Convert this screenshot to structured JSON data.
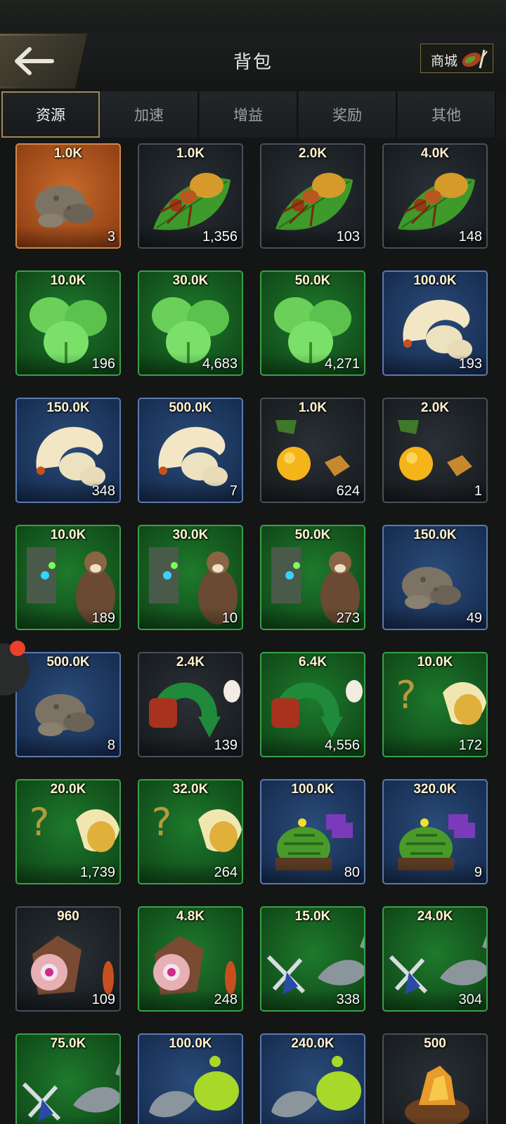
{
  "header": {
    "title": "背包",
    "shop_label": "商城"
  },
  "tabs": [
    {
      "label": "资源",
      "active": true
    },
    {
      "label": "加速",
      "active": false
    },
    {
      "label": "增益",
      "active": false
    },
    {
      "label": "奖励",
      "active": false
    },
    {
      "label": "其他",
      "active": false
    }
  ],
  "items": [
    {
      "amount": "1.0K",
      "count": "3",
      "bg": "orange",
      "icon": "soil-icon"
    },
    {
      "amount": "1.0K",
      "count": "1,356",
      "bg": "dark",
      "icon": "ant-on-leaf-icon"
    },
    {
      "amount": "2.0K",
      "count": "103",
      "bg": "dark",
      "icon": "ant-on-leaf-icon"
    },
    {
      "amount": "4.0K",
      "count": "148",
      "bg": "dark",
      "icon": "ant-on-leaf-icon"
    },
    {
      "amount": "10.0K",
      "count": "196",
      "bg": "green",
      "icon": "leaf-icon"
    },
    {
      "amount": "30.0K",
      "count": "4,683",
      "bg": "green",
      "icon": "leaf-icon"
    },
    {
      "amount": "50.0K",
      "count": "4,271",
      "bg": "green",
      "icon": "leaf-icon"
    },
    {
      "amount": "100.0K",
      "count": "193",
      "bg": "blue",
      "icon": "larva-icon"
    },
    {
      "amount": "150.0K",
      "count": "348",
      "bg": "blue",
      "icon": "larva-icon"
    },
    {
      "amount": "500.0K",
      "count": "7",
      "bg": "blue",
      "icon": "larva-icon"
    },
    {
      "amount": "1.0K",
      "count": "624",
      "bg": "dark",
      "icon": "resource-bundle-icon"
    },
    {
      "amount": "2.0K",
      "count": "1",
      "bg": "dark",
      "icon": "resource-bundle-icon"
    },
    {
      "amount": "10.0K",
      "count": "189",
      "bg": "green",
      "icon": "creature-bundle-icon"
    },
    {
      "amount": "30.0K",
      "count": "10",
      "bg": "green",
      "icon": "creature-bundle-icon"
    },
    {
      "amount": "50.0K",
      "count": "273",
      "bg": "green",
      "icon": "creature-bundle-icon"
    },
    {
      "amount": "150.0K",
      "count": "49",
      "bg": "blue",
      "icon": "soil-icon"
    },
    {
      "amount": "500.0K",
      "count": "8",
      "bg": "blue",
      "icon": "soil-icon"
    },
    {
      "amount": "2.4K",
      "count": "139",
      "bg": "dark",
      "icon": "red-ant-arrow-icon"
    },
    {
      "amount": "6.4K",
      "count": "4,556",
      "bg": "green",
      "icon": "red-ant-arrow-icon"
    },
    {
      "amount": "10.0K",
      "count": "172",
      "bg": "green",
      "icon": "mystery-fungus-icon"
    },
    {
      "amount": "20.0K",
      "count": "1,739",
      "bg": "green",
      "icon": "mystery-fungus-icon"
    },
    {
      "amount": "32.0K",
      "count": "264",
      "bg": "green",
      "icon": "mystery-fungus-icon"
    },
    {
      "amount": "100.0K",
      "count": "80",
      "bg": "blue",
      "icon": "melon-puzzle-icon"
    },
    {
      "amount": "320.0K",
      "count": "9",
      "bg": "blue",
      "icon": "melon-puzzle-icon"
    },
    {
      "amount": "960",
      "count": "109",
      "bg": "dark",
      "icon": "pearl-shell-icon"
    },
    {
      "amount": "4.8K",
      "count": "248",
      "bg": "green",
      "icon": "pearl-shell-icon"
    },
    {
      "amount": "15.0K",
      "count": "338",
      "bg": "green",
      "icon": "fish-swords-icon"
    },
    {
      "amount": "24.0K",
      "count": "304",
      "bg": "green",
      "icon": "fish-swords-icon"
    },
    {
      "amount": "75.0K",
      "count": "",
      "bg": "green",
      "icon": "fish-swords-icon"
    },
    {
      "amount": "100.0K",
      "count": "",
      "bg": "blue",
      "icon": "fish-slime-icon"
    },
    {
      "amount": "240.0K",
      "count": "",
      "bg": "blue",
      "icon": "fish-slime-icon"
    },
    {
      "amount": "500",
      "count": "",
      "bg": "dark",
      "icon": "amber-rock-icon"
    }
  ]
}
